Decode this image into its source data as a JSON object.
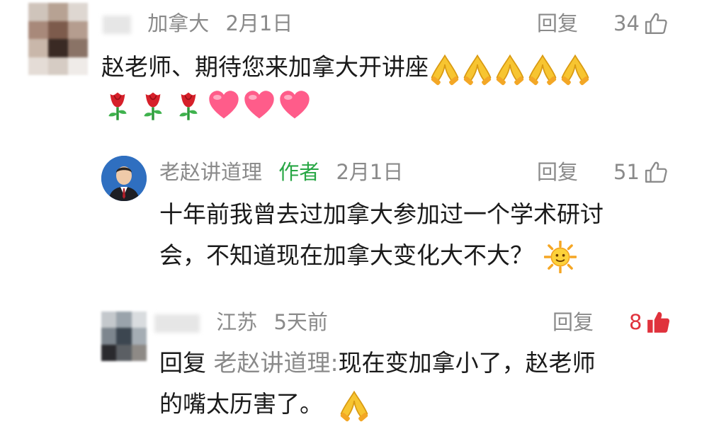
{
  "comments": [
    {
      "location": "加拿大",
      "date": "2月1日",
      "reply_label": "回复",
      "likes": "34",
      "text": "赵老师、期待您来加拿大开讲座",
      "emojis_line1": [
        "praying-hands",
        "praying-hands",
        "praying-hands",
        "praying-hands",
        "praying-hands"
      ],
      "emojis_line2": [
        "rose",
        "rose",
        "rose",
        "heart",
        "heart",
        "heart"
      ]
    },
    {
      "name": "老赵讲道理",
      "author_tag": "作者",
      "date": "2月1日",
      "reply_label": "回复",
      "likes": "51",
      "text_line1": "十年前我曾去过加拿大参加过一个学术研讨",
      "text_line2": "会，不知道现在加拿大变化大不大？",
      "emoji": "sun"
    },
    {
      "location": "江苏",
      "date": "5天前",
      "reply_label": "回复",
      "likes": "8",
      "liked": true,
      "reply_prefix": "回复",
      "mention": "老赵讲道理:",
      "text_line1": "现在变加拿小了，赵老师",
      "text_line2": "的嘴太历害了。",
      "emoji": "praying-hands"
    }
  ],
  "colors": {
    "meta": "#8a8a8a",
    "author": "#28a745",
    "liked": "#e0323c",
    "text": "#1a1a1a"
  }
}
